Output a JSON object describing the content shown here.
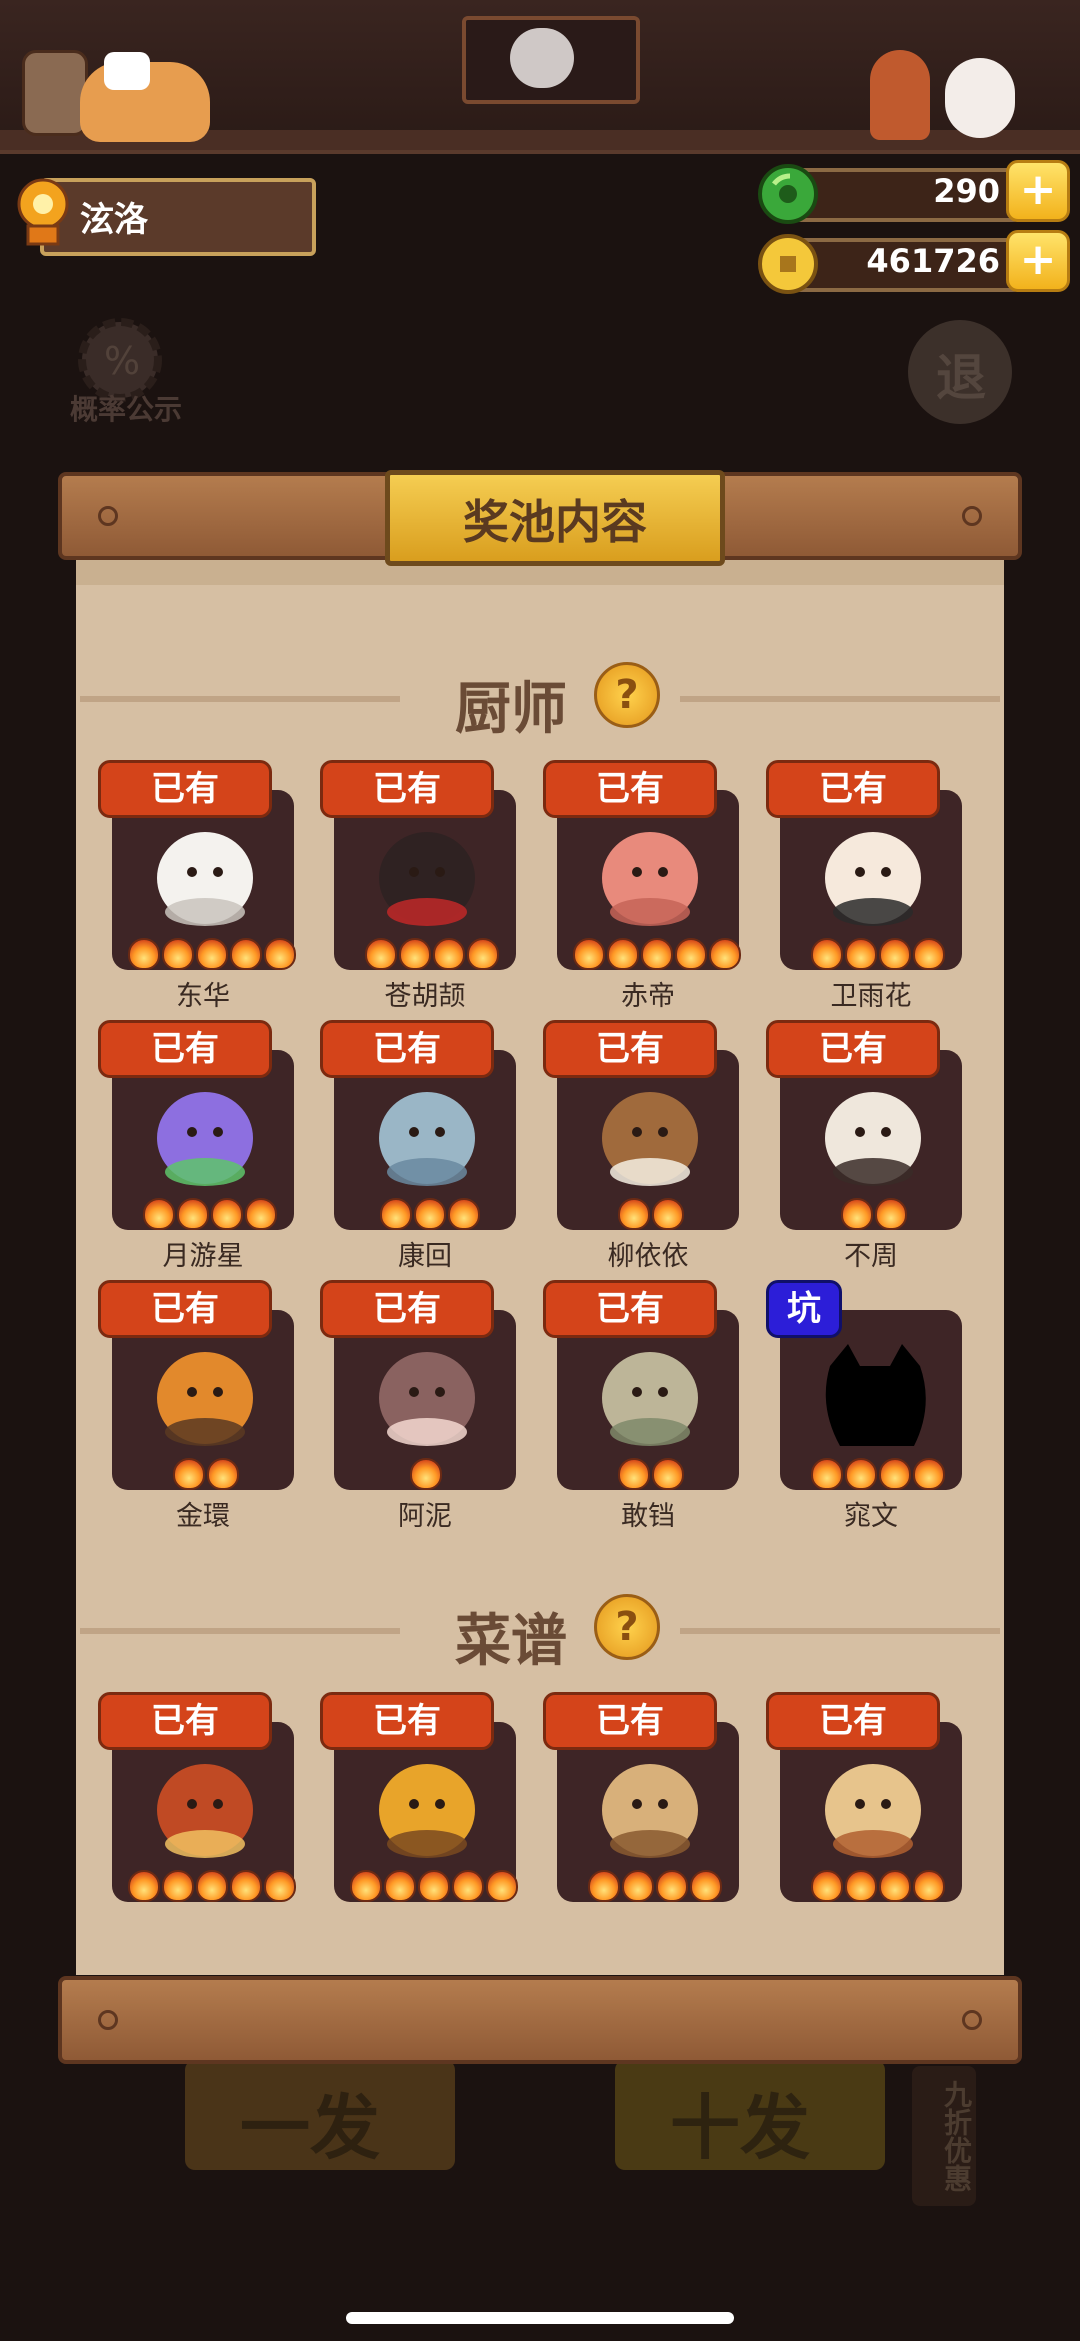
{
  "player": {
    "name": "泫洛"
  },
  "currency": {
    "jade": "290",
    "coin": "461726",
    "plus": "+"
  },
  "background": {
    "probability_label": "概率公示",
    "exit_label": "退",
    "draw_one": "一发",
    "draw_ten": "十发",
    "discount": "九折优惠"
  },
  "panel": {
    "title": "奖池内容"
  },
  "chef_section": {
    "title": "厨师",
    "help": "?"
  },
  "recipe_section": {
    "title": "菜谱",
    "help": "?"
  },
  "chefs": [
    {
      "tag": "已有",
      "name": "东华",
      "flames": 5,
      "art": "white-bird"
    },
    {
      "tag": "已有",
      "name": "苍胡颉",
      "flames": 4,
      "art": "red-bowl"
    },
    {
      "tag": "已有",
      "name": "赤帝",
      "flames": 5,
      "art": "pink-monkey"
    },
    {
      "tag": "已有",
      "name": "卫雨花",
      "flames": 4,
      "art": "child"
    },
    {
      "tag": "已有",
      "name": "月游星",
      "flames": 4,
      "art": "purple-blob"
    },
    {
      "tag": "已有",
      "name": "康回",
      "flames": 3,
      "art": "blue-fish"
    },
    {
      "tag": "已有",
      "name": "柳依依",
      "flames": 2,
      "art": "tree-stump"
    },
    {
      "tag": "已有",
      "name": "不周",
      "flames": 2,
      "art": "panda-cat"
    },
    {
      "tag": "已有",
      "name": "金環",
      "flames": 2,
      "art": "golden-ring"
    },
    {
      "tag": "已有",
      "name": "阿泥",
      "flames": 1,
      "art": "mud-child"
    },
    {
      "tag": "已有",
      "name": "敢铛",
      "flames": 2,
      "art": "stone-monkey"
    },
    {
      "tag": "坑",
      "name": "窕文",
      "flames": 4,
      "art": "silhouette"
    }
  ],
  "recipes": [
    {
      "tag": "已有",
      "name": "",
      "flames": 5,
      "art": "meat-platter"
    },
    {
      "tag": "已有",
      "name": "",
      "flames": 5,
      "art": "gold-pot"
    },
    {
      "tag": "已有",
      "name": "",
      "flames": 4,
      "art": "fish-boat"
    },
    {
      "tag": "已有",
      "name": "",
      "flames": 4,
      "art": "bun-basket"
    }
  ]
}
